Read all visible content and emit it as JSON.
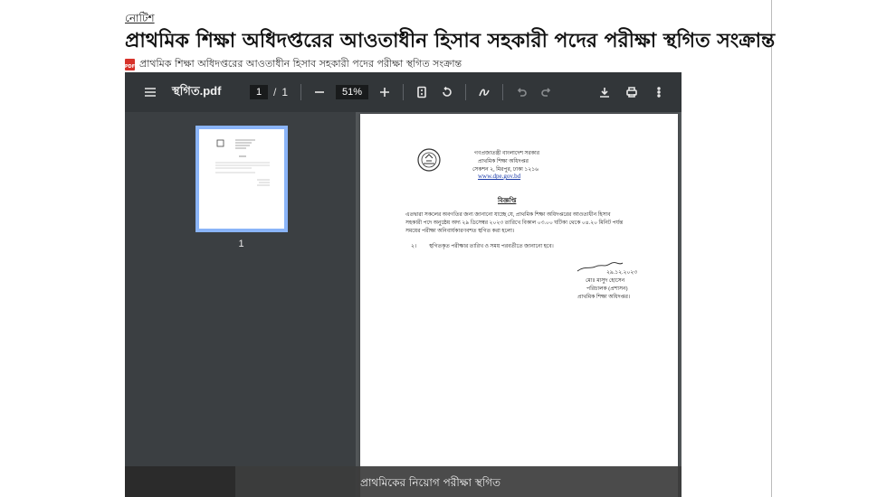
{
  "article": {
    "category": "নোটিশ",
    "headline": "প্রাথমিক শিক্ষা অধিদপ্তরের আওতাধীন হিসাব সহকারী পদের পরীক্ষা স্থগিত সংক্রান্ত",
    "pdf_link": "প্রাথমিক শিক্ষা অধিদপ্তরের আওতাধীন হিসাব সহকারী পদের পরীক্ষা স্থগিত সংক্রান্ত",
    "pdf_badge": "PDF"
  },
  "viewer": {
    "file_name": "স্থগিত.pdf",
    "current_page": "1",
    "page_separator": "/",
    "total_pages": "1",
    "zoom": "51%",
    "thumbnail_label": "1",
    "caption": "প্রাথমিকের নিয়োগ পরীক্ষা স্থগিত"
  },
  "document": {
    "gov_line": "গণপ্রজাতন্ত্রী বাংলাদেশ সরকার",
    "office": "প্রাথমিক শিক্ষা অধিদপ্তর",
    "address": "সেকশন ২, মিরপুর, ঢাকা ১২১৬",
    "website": "www.dpe.gov.bd",
    "heading": "বিজ্ঞপ্তি",
    "body_1": "এতদ্বারা সকলের অবগতির জন্য জানানো যাচ্ছে যে, প্রাথমিক শিক্ষা অধিদপ্তরের আওতাধীন হিসাব",
    "body_2": "সহকারী পদে অনুষ্ঠেয় অদ্য ২৯ ডিসেম্বর ২০২৩ তারিখে বিকাল ০৩.০০ ঘটিকা থেকে ০৪.২০ মিনিট পর্যন্ত",
    "body_3": "সময়ের পরীক্ষা অনিবার্যকারণবশত স্থগিত করা হলো।",
    "item_num": "২।",
    "item_text": "স্থগিতকৃত পরীক্ষার তারিখ ও সময় পরবর্তীতে জানানো হবে।",
    "sign_date": "২৯.১২.২০২৩",
    "sign_name": "মোঃ মাসুদ হোসেন",
    "sign_title": "পরিচালক (প্রশাসন)",
    "sign_office": "প্রাথমিক শিক্ষা অধিদপ্তর।"
  }
}
